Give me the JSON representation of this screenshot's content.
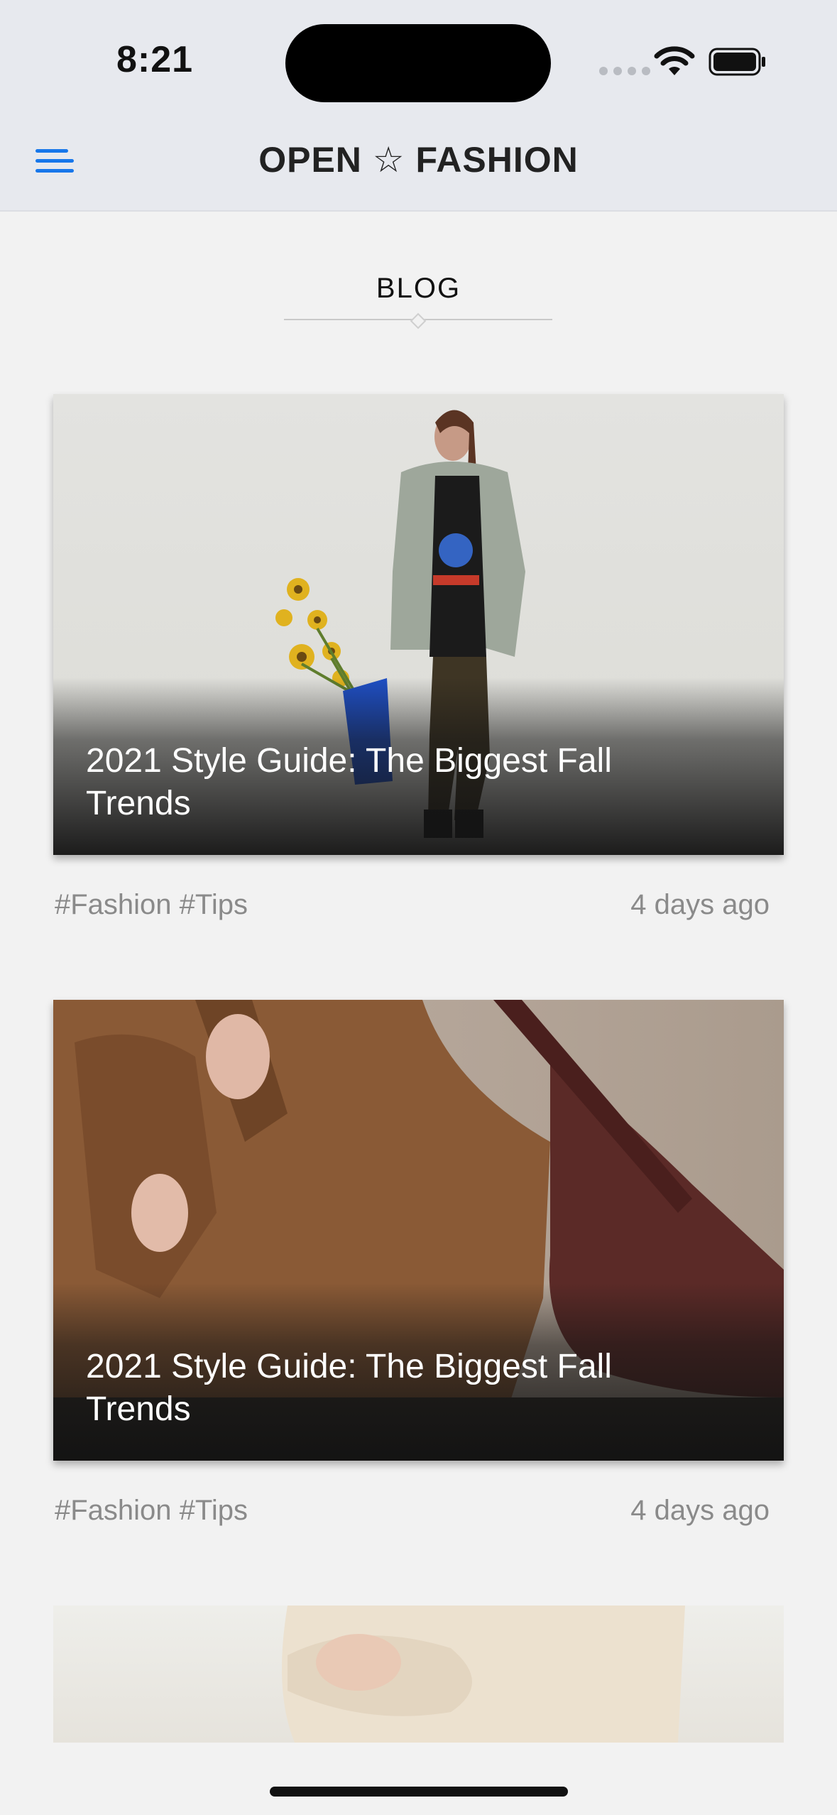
{
  "status_bar": {
    "time": "8:21"
  },
  "nav": {
    "title": "OPEN ☆ FASHION",
    "menu_icon": "menu-icon",
    "accent_color": "#1877ea"
  },
  "section": {
    "title": "BLOG"
  },
  "posts": [
    {
      "title": "2021 Style Guide: The Biggest Fall Trends",
      "tags": "#Fashion #Tips",
      "time": "4 days ago"
    },
    {
      "title": "2021 Style Guide: The Biggest Fall Trends",
      "tags": "#Fashion #Tips",
      "time": "4 days ago"
    }
  ]
}
